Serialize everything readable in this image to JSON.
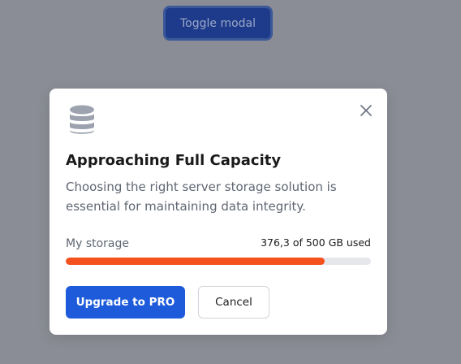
{
  "toggle": {
    "label": "Toggle modal"
  },
  "modal": {
    "icon": "database-icon",
    "close_icon": "close-icon",
    "title": "Approaching Full Capacity",
    "description": "Choosing the right server storage solution is essential for maintaining data integrity.",
    "storage": {
      "label": "My storage",
      "usage_text": "376,3 of 500 GB used",
      "used_fraction": 0.8486
    },
    "buttons": {
      "upgrade_label": "Upgrade to PRO",
      "cancel_label": "Cancel"
    }
  },
  "colors": {
    "backdrop": "#8a8d95",
    "toggle_bg": "#1e3a8a",
    "accent": "#1d5bdb",
    "progress_fill": "#f4511e",
    "progress_track": "#e5e7eb",
    "icon": "#9ca3af"
  }
}
